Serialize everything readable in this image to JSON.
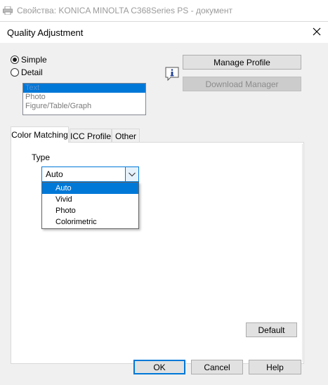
{
  "parent_window": {
    "title": "Свойства: KONICA MINOLTA C368Series PS - документ",
    "icon": "printer-icon"
  },
  "dialog": {
    "title": "Quality Adjustment",
    "close_icon": "close-icon"
  },
  "mode": {
    "options": [
      {
        "label": "Simple",
        "checked": true
      },
      {
        "label": "Detail",
        "checked": false
      }
    ]
  },
  "content_list": {
    "items": [
      "Text",
      "Photo",
      "Figure/Table/Graph"
    ],
    "selected_index": 0
  },
  "buttons": {
    "manage_profile": "Manage Profile",
    "download_manager": "Download Manager",
    "default": "Default",
    "ok": "OK",
    "cancel": "Cancel",
    "help": "Help"
  },
  "tabs": [
    {
      "label": "Color Matching",
      "active": true
    },
    {
      "label": "ICC Profile",
      "active": false
    },
    {
      "label": "Other",
      "active": false
    }
  ],
  "type_field": {
    "label": "Type",
    "value": "Auto",
    "options": [
      "Auto",
      "Vivid",
      "Photo",
      "Colorimetric"
    ],
    "selected_index": 0
  },
  "colors": {
    "accent": "#0078d7",
    "dialog_bg": "#f0f0f0",
    "button_bg": "#e1e1e1"
  }
}
